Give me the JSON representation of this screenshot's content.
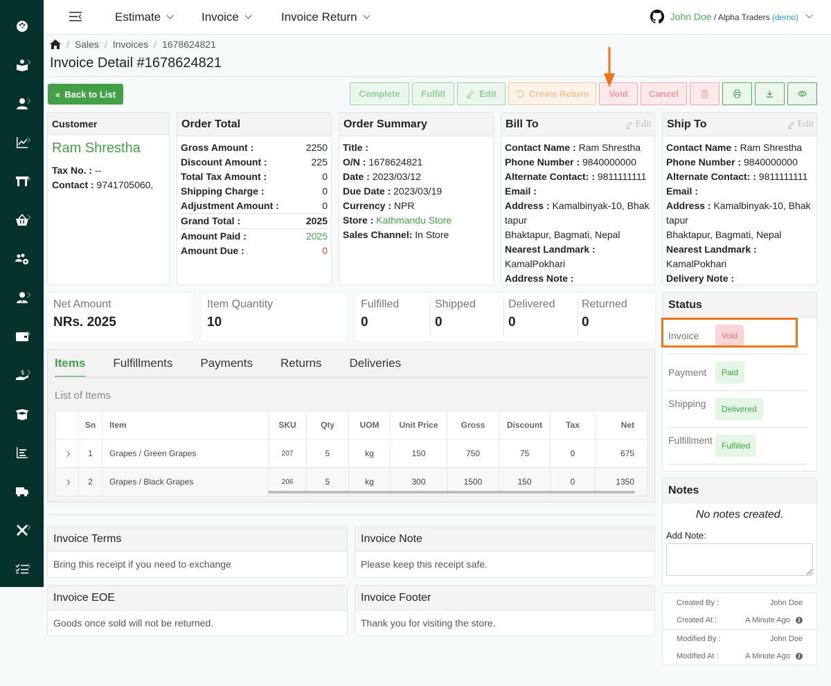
{
  "sidebar": {
    "items": [
      {
        "icon": "dashboard-icon",
        "has_submenu": false
      },
      {
        "icon": "catalog-icon",
        "has_submenu": true
      },
      {
        "icon": "user-icon",
        "has_submenu": true
      },
      {
        "icon": "analytics-icon",
        "has_submenu": true
      },
      {
        "icon": "store-icon",
        "has_submenu": true
      },
      {
        "icon": "basket-icon",
        "has_submenu": true
      },
      {
        "icon": "team-settings-icon",
        "has_submenu": false
      },
      {
        "icon": "employee-icon",
        "has_submenu": true
      },
      {
        "icon": "wallet-icon",
        "has_submenu": true
      },
      {
        "icon": "payment-hand-icon",
        "has_submenu": true
      },
      {
        "icon": "open-box-icon",
        "has_submenu": false
      },
      {
        "icon": "report-icon",
        "has_submenu": false
      },
      {
        "icon": "truck-icon",
        "has_submenu": false
      },
      {
        "icon": "tools-icon",
        "has_submenu": true
      },
      {
        "icon": "checklist-icon",
        "has_submenu": true
      }
    ]
  },
  "topbar": {
    "menus": [
      "Estimate",
      "Invoice",
      "Invoice Return"
    ],
    "user": {
      "name": "John Doe",
      "org": " / Alpha Traders ",
      "demo": "(demo)"
    }
  },
  "breadcrumb": [
    "Sales",
    "Invoices",
    "1678624821"
  ],
  "page_title": "Invoice Detail #1678624821",
  "buttons": {
    "back": "Back to List",
    "complete": "Complete",
    "fulfill": "Fulfill",
    "edit": "Edit",
    "create_return": "Create Return",
    "void": "Void",
    "cancel": "Cancel"
  },
  "customer": {
    "heading": "Customer",
    "name": "Ram Shrestha",
    "tax_label": "Tax No. :",
    "tax_value": " --",
    "contact_label": "Contact :",
    "contact_value": " 9741705060,"
  },
  "order_total": {
    "heading": "Order Total",
    "rows": [
      {
        "label": "Gross Amount :",
        "value": "2250"
      },
      {
        "label": "Discount Amount :",
        "value": "225"
      },
      {
        "label": "Total Tax Amount :",
        "value": "0"
      },
      {
        "label": "Shipping Charge :",
        "value": "0"
      },
      {
        "label": "Adjustment Amount :",
        "value": "0"
      }
    ],
    "grand_total_label": "Grand Total :",
    "grand_total": "2025",
    "paid_label": "Amount Paid :",
    "paid": "2025",
    "due_label": "Amount Due :",
    "due": "0"
  },
  "order_summary": {
    "heading": "Order Summary",
    "rows": [
      {
        "label": "Title :",
        "value": ""
      },
      {
        "label": "O/N :",
        "value": " 1678624821"
      },
      {
        "label": "Date :",
        "value": " 2023/03/12"
      },
      {
        "label": "Due Date :",
        "value": " 2023/03/19"
      },
      {
        "label": "Currency :",
        "value": " NPR"
      }
    ],
    "store_label": "Store :",
    "store_value": "Kathmandu Store",
    "channel_label": "Sales Channel:",
    "channel_value": " In Store"
  },
  "bill_to": {
    "heading": "Bill To",
    "edit": "Edit",
    "contact_name_label": "Contact Name :",
    "contact_name": " Ram Shrestha",
    "phone_label": "Phone Number :",
    "phone": " 9840000000",
    "alt_label": "Alternate Contact: :",
    "alt": " 9811111111",
    "email_label": "Email :",
    "email": "",
    "address_label": "Address :",
    "address": " Kamalbinyak-10, Bhaktapur",
    "address_line2": "Bhaktapur, Bagmati, Nepal",
    "landmark_label": "Nearest Landmark :",
    "landmark": " KamalPokhari",
    "note_label": "Address Note :",
    "note": ""
  },
  "ship_to": {
    "heading": "Ship To",
    "edit": "Edit",
    "contact_name_label": "Contact Name :",
    "contact_name": " Ram Shrestha",
    "phone_label": "Phone Number :",
    "phone": " 9840000000",
    "alt_label": "Alternate Contact: :",
    "alt": " 9811111111",
    "email_label": "Email :",
    "email": "",
    "address_label": "Address :",
    "address": " Kamalbinyak-10, Bhaktapur",
    "address_line2": "Bhaktapur, Bagmati, Nepal",
    "landmark_label": "Nearest Landmark :",
    "landmark": " KamalPokhari",
    "note_label": "Delivery Note :",
    "note": ""
  },
  "stats": {
    "net_amount_label": "Net Amount",
    "net_amount": "NRs. 2025",
    "item_qty_label": "Item Quantity",
    "item_qty": "10",
    "fulfilled_label": "Fulfilled",
    "fulfilled": "0",
    "shipped_label": "Shipped",
    "shipped": "0",
    "delivered_label": "Delivered",
    "delivered": "0",
    "returned_label": "Returned",
    "returned": "0"
  },
  "tabs": [
    "Items",
    "Fulfillments",
    "Payments",
    "Returns",
    "Deliveries"
  ],
  "items_table": {
    "title": "List of Items",
    "columns": [
      "",
      "Sn",
      "Item",
      "SKU",
      "Qty",
      "UOM",
      "Unit Price",
      "Gross",
      "Discount",
      "Tax",
      "Net"
    ],
    "rows": [
      {
        "sn": "1",
        "item": "Grapes / Green Grapes",
        "sku": "207",
        "qty": "5",
        "uom": "kg",
        "unit_price": "150",
        "gross": "750",
        "discount": "75",
        "tax": "0",
        "net": "675"
      },
      {
        "sn": "2",
        "item": "Grapes / Black Grapes",
        "sku": "206",
        "qty": "5",
        "uom": "kg",
        "unit_price": "300",
        "gross": "1500",
        "discount": "150",
        "tax": "0",
        "net": "1350"
      }
    ]
  },
  "footer_cards": {
    "terms_heading": "Invoice Terms",
    "terms": "Bring this receipt if you need to exchange",
    "note_heading": "Invoice Note",
    "note": "Please keep this receipt safe.",
    "eoe_heading": "Invoice EOE",
    "eoe": "Goods once sold will not be returned.",
    "footer_heading": "Invoice Footer",
    "footer": "Thank you for visiting the store."
  },
  "status": {
    "heading": "Status",
    "rows": [
      {
        "label": "Invoice",
        "value": "Void"
      },
      {
        "label": "Payment",
        "value": "Paid"
      },
      {
        "label": "Shipping",
        "value": "Delivered"
      },
      {
        "label": "Fulfillment",
        "value": "Fulfilled"
      }
    ]
  },
  "notes": {
    "heading": "Notes",
    "empty": "No notes created.",
    "add_label": "Add Note:",
    "input_value": ""
  },
  "meta": {
    "created_by_label": "Created By :",
    "created_by": "John Doe",
    "created_at_label": "Created At :",
    "created_at": "A Minute Ago",
    "modified_by_label": "Modified By :",
    "modified_by": "John Doe",
    "modified_at_label": "Modified At :",
    "modified_at": "A Minute Ago"
  },
  "colors": {
    "sidebar_bg": "#05322a",
    "accent_green": "#43a047",
    "void_red": "#ef6f7c",
    "highlight_orange": "#f07314"
  }
}
